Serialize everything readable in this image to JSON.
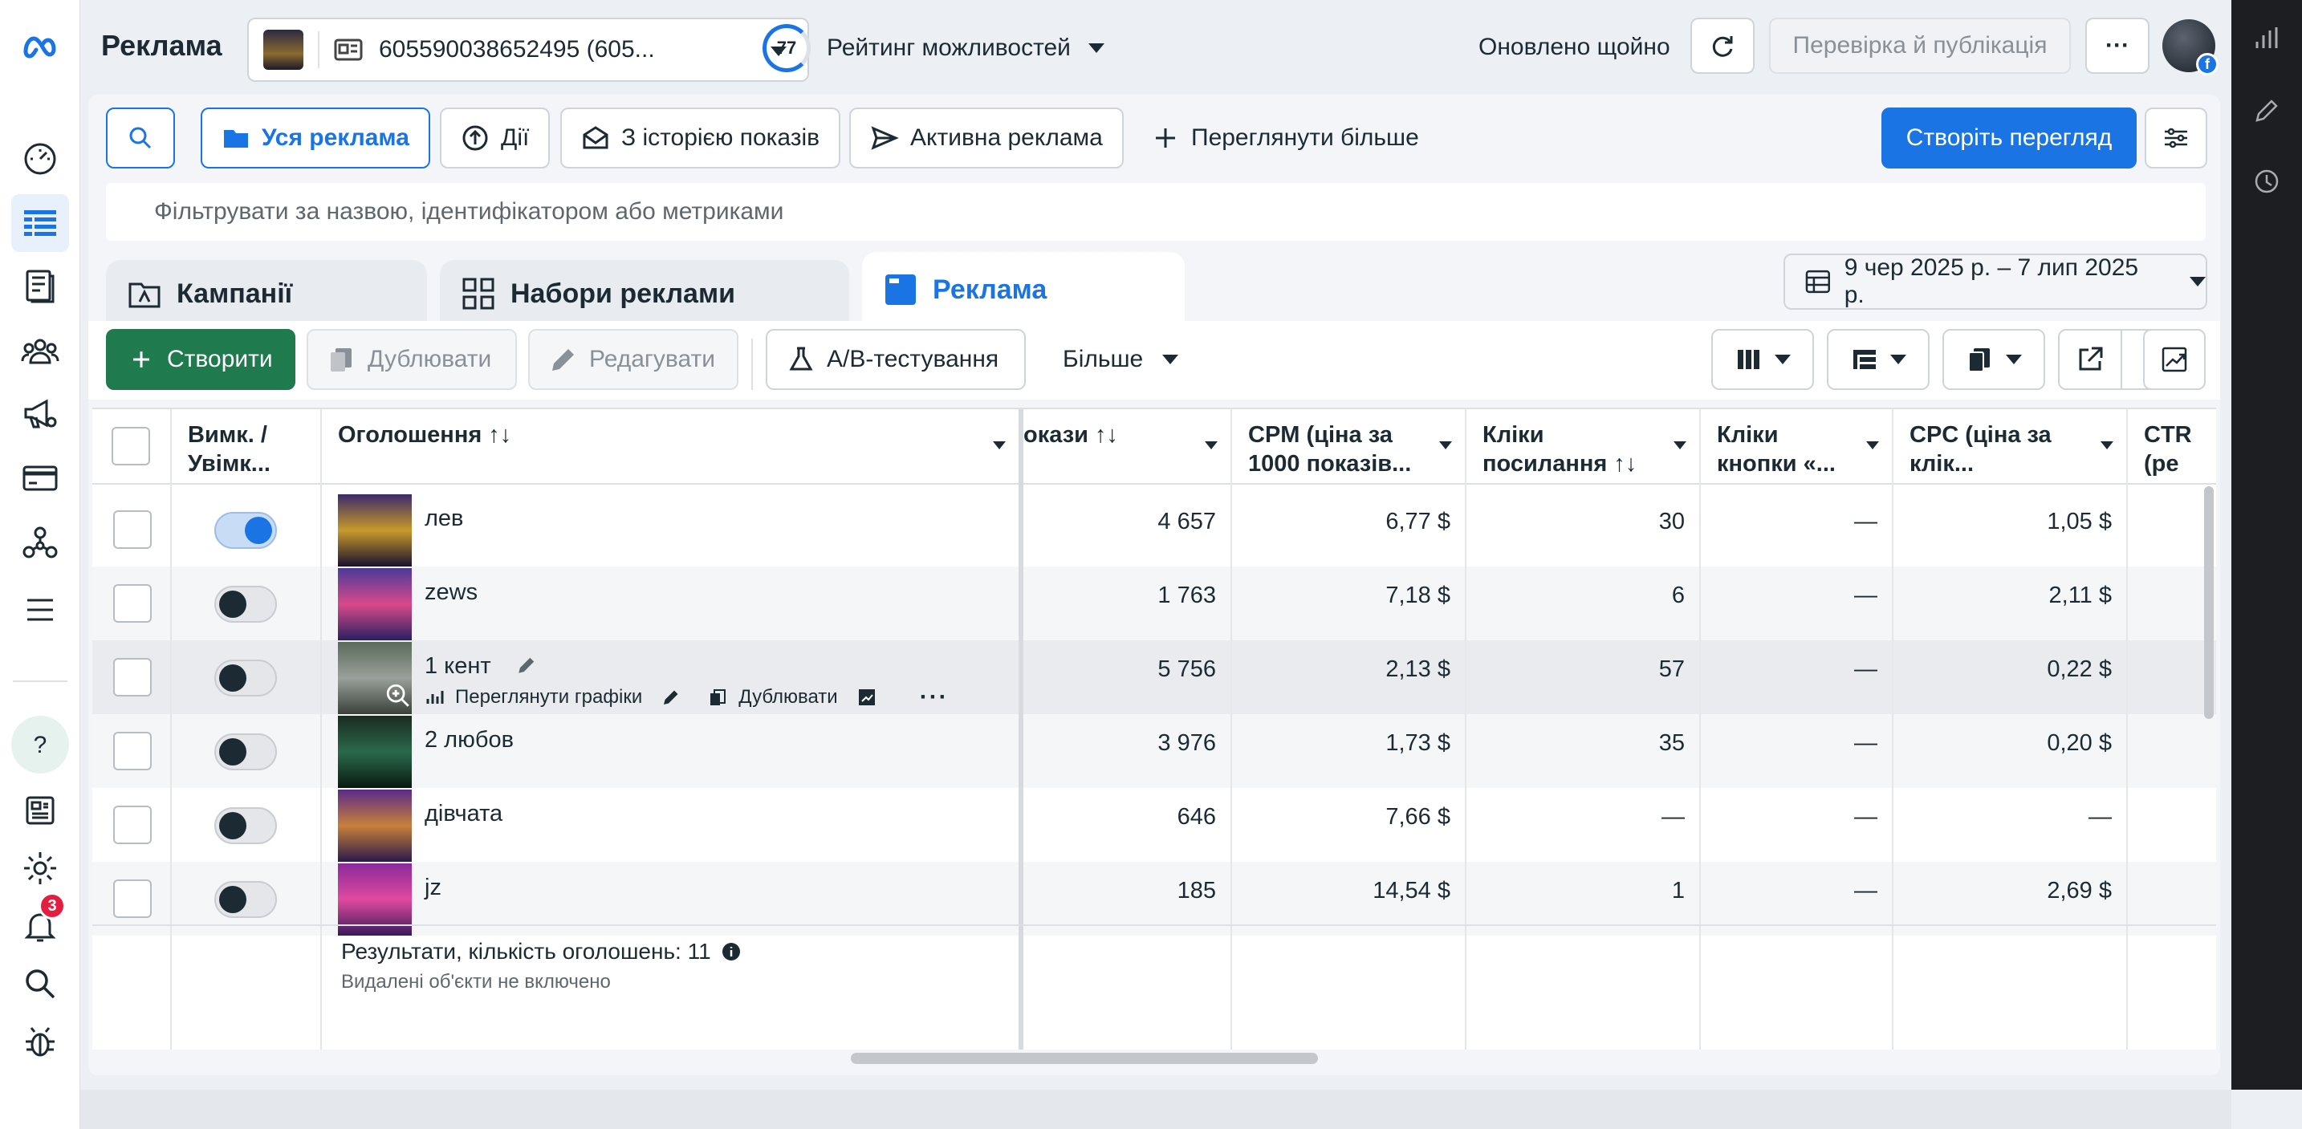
{
  "header": {
    "title": "Реклама",
    "account_label": "605590038652495 (605...",
    "score_value": "77",
    "score_label": "Рейтинг можливостей",
    "updated_text": "Оновлено щойно",
    "publish_label": "Перевірка й публікація",
    "more_label": "···"
  },
  "left_nav": [
    {
      "name": "meta-logo-icon"
    },
    {
      "name": "dashboard-icon"
    },
    {
      "name": "ads-manager-table-icon"
    },
    {
      "name": "pages-icon"
    },
    {
      "name": "audiences-icon"
    },
    {
      "name": "campaign-megaphone-icon"
    },
    {
      "name": "billing-card-icon"
    },
    {
      "name": "business-assets-icon"
    },
    {
      "name": "menu-icon"
    },
    {
      "name": "help-icon"
    },
    {
      "name": "news-icon"
    },
    {
      "name": "settings-gear-icon"
    },
    {
      "name": "notifications-bell-icon"
    },
    {
      "name": "search-icon"
    },
    {
      "name": "bug-report-icon"
    }
  ],
  "notifications_badge": "3",
  "view_bar": {
    "all_ads": "Уся реклама",
    "actions": "Дії",
    "with_history": "З історією показів",
    "active_ads": "Активна реклама",
    "view_more": "Переглянути більше",
    "create_view": "Створіть перегляд"
  },
  "filter_placeholder": "Фільтрувати за назвою, ідентифікатором або метриками",
  "tabs": {
    "campaigns": "Кампанії",
    "adsets": "Набори реклами",
    "ads": "Реклама"
  },
  "date_range": "9 чер 2025 р. – 7 лип 2025 р.",
  "toolbar": {
    "create": "Створити",
    "duplicate": "Дублювати",
    "edit": "Редагувати",
    "ab_test": "A/B-тестування",
    "more": "Більше"
  },
  "columns": {
    "toggle": "Вимк. / Увімк...",
    "ad_name": "Оголошення ↑↓",
    "impressions": "окази ↑↓",
    "cpm": "CPM (ціна за 1000 показів...",
    "link_clicks": "Кліки посилання ↑↓",
    "button_clicks": "Кліки кнопки «...",
    "cpc": "CPC (ціна за клік...",
    "ctr": "CTR (ре кліків)"
  },
  "rows": [
    {
      "name": "лев",
      "on": true,
      "impressions": "4 657",
      "cpm": "6,77 $",
      "link_clicks": "30",
      "button_clicks": "—",
      "cpc": "1,05 $",
      "thumb_colors": [
        "#3a2a6a",
        "#c79a2a",
        "#1a1030"
      ]
    },
    {
      "name": "zews",
      "on": false,
      "impressions": "1 763",
      "cpm": "7,18 $",
      "link_clicks": "6",
      "button_clicks": "—",
      "cpc": "2,11 $",
      "thumb_colors": [
        "#4a3a9a",
        "#d84a8a",
        "#2a2060"
      ]
    },
    {
      "name": "1 кент",
      "on": false,
      "impressions": "5 756",
      "cpm": "2,13 $",
      "link_clicks": "57",
      "button_clicks": "—",
      "cpc": "0,22 $",
      "thumb_colors": [
        "#5a6a5a",
        "#9aa09a",
        "#3a403a"
      ]
    },
    {
      "name": "2 любов",
      "on": false,
      "impressions": "3 976",
      "cpm": "1,73 $",
      "link_clicks": "35",
      "button_clicks": "—",
      "cpc": "0,20 $",
      "thumb_colors": [
        "#1a2a20",
        "#2a6a4a",
        "#0a1a10"
      ]
    },
    {
      "name": "дівчата",
      "on": false,
      "impressions": "646",
      "cpm": "7,66 $",
      "link_clicks": "—",
      "button_clicks": "—",
      "cpc": "—",
      "thumb_colors": [
        "#5a2a8a",
        "#c8803a",
        "#2a1a4a"
      ]
    },
    {
      "name": "jz",
      "on": false,
      "impressions": "185",
      "cpm": "14,54 $",
      "link_clicks": "1",
      "button_clicks": "—",
      "cpc": "2,69 $",
      "thumb_colors": [
        "#8a2a9a",
        "#e04aa0",
        "#3a1a5a"
      ]
    }
  ],
  "hover_actions": {
    "view_charts": "Переглянути графіки",
    "duplicate": "Дублювати"
  },
  "footer": {
    "results": "Результати, кількість оголошень: 11",
    "deleted_note": "Видалені об'єкти не включено"
  },
  "colors": {
    "accent": "#1b74e4",
    "create_green": "#1f7a4d",
    "badge_red": "#e41e3f"
  }
}
